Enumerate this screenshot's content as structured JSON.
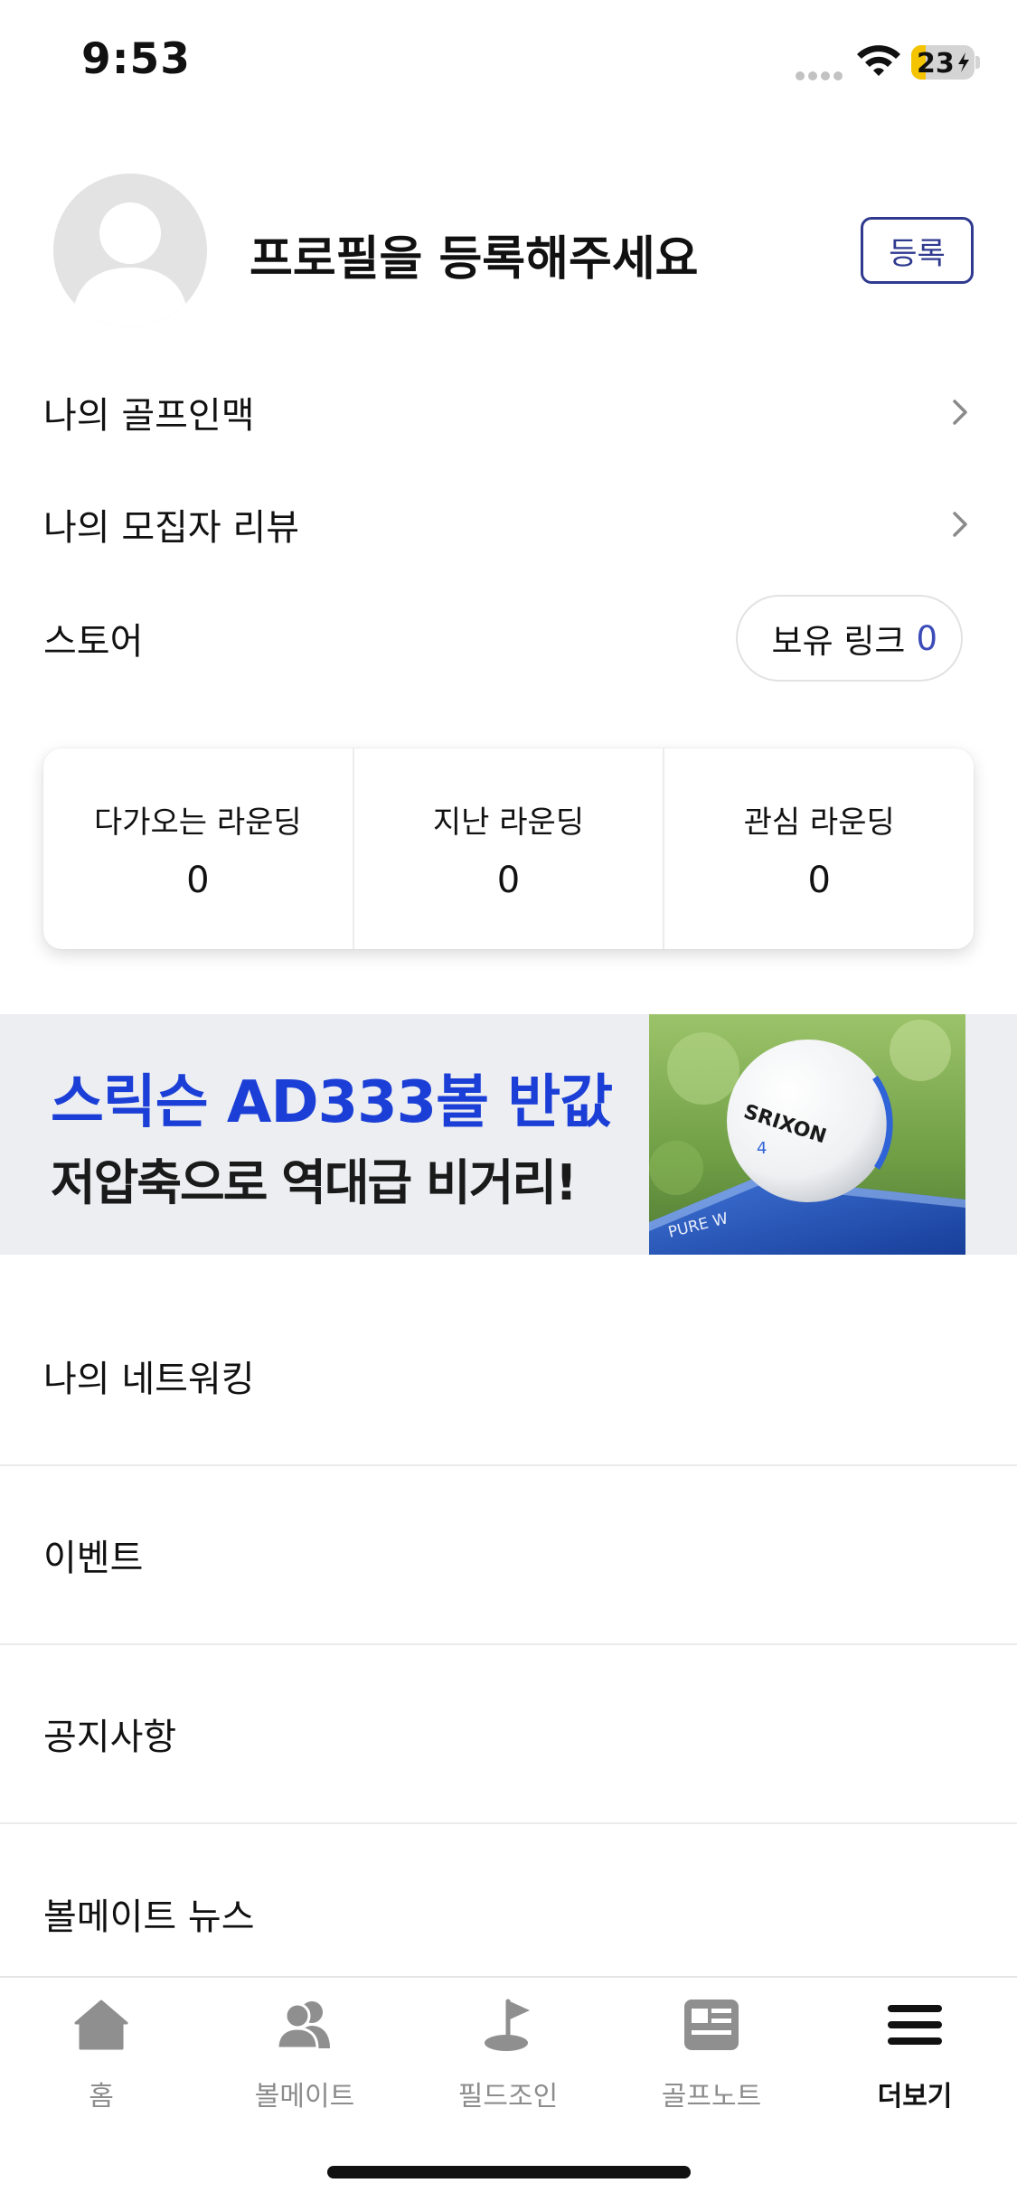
{
  "status_bar": {
    "time": "9:53",
    "battery_level": "23",
    "battery_fraction": 0.23,
    "battery_color": "#f5c400",
    "icons": [
      "signal-dots-icon",
      "wifi-icon",
      "battery-charging-icon"
    ]
  },
  "profile": {
    "title": "프로필을 등록해주세요",
    "register_label": "등록",
    "avatar_icon": "default-avatar-icon"
  },
  "menu_rows": {
    "golf_network": "나의 골프인맥",
    "recruiter_review": "나의 모집자 리뷰",
    "store": "스토어",
    "store_link_label": "보유 링크",
    "store_link_count": "0"
  },
  "rounding_stats": [
    {
      "label": "다가오는 라운딩",
      "value": "0"
    },
    {
      "label": "지난 라운딩",
      "value": "0"
    },
    {
      "label": "관심 라운딩",
      "value": "0"
    }
  ],
  "banner": {
    "line1": "스릭슨 AD333볼 반값",
    "line2": "저압축으로 역대급 비거리!",
    "image_text": "SRIXON",
    "image_number": "4",
    "box_text": "PURE W",
    "accent_color": "#1b3fd6"
  },
  "list": [
    "나의 네트워킹",
    "이벤트",
    "공지사항",
    "볼메이트 뉴스"
  ],
  "tabs": [
    {
      "label": "홈",
      "icon": "home-icon"
    },
    {
      "label": "볼메이트",
      "icon": "people-icon"
    },
    {
      "label": "필드조인",
      "icon": "flag-icon"
    },
    {
      "label": "골프노트",
      "icon": "note-icon"
    },
    {
      "label": "더보기",
      "icon": "menu-icon",
      "active": true
    }
  ]
}
